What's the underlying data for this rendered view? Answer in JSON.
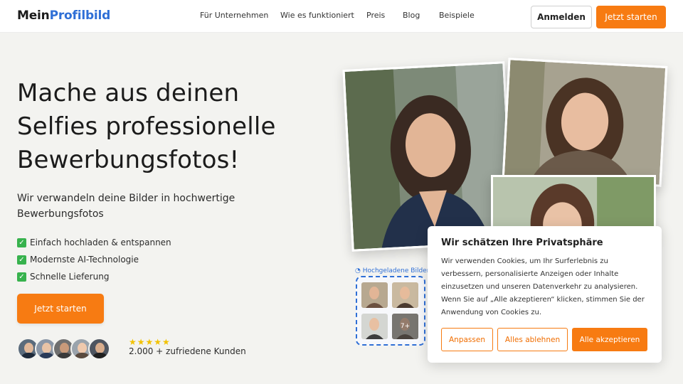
{
  "brand": {
    "part1": "Mein",
    "part2": "Profilbild"
  },
  "nav": [
    {
      "label": "Für Unternehmen"
    },
    {
      "label": "Wie es funktioniert"
    },
    {
      "label": "Preis"
    },
    {
      "label": "Blog"
    },
    {
      "label": "Beispiele"
    }
  ],
  "header": {
    "login_label": "Anmelden",
    "start_label": "Jetzt starten"
  },
  "hero": {
    "title": "Mache aus deinen Selfies professionelle Bewerbungsfotos!",
    "subtitle": "Wir verwandeln deine Bilder in hochwertige Bewerbungsfotos",
    "bullets": [
      {
        "icon": "checkmark-icon",
        "text": "Einfach hochladen & entspannen"
      },
      {
        "icon": "checkmark-icon",
        "text": "Modernste AI-Technologie"
      },
      {
        "icon": "checkmark-icon",
        "text": "Schnelle Lieferung"
      }
    ],
    "cta_label": "Jetzt starten",
    "stars": "★★★★★",
    "customers_text": "2.000 + zufriedene Kunden"
  },
  "uploads": {
    "label": "Hochgeladene Bilder",
    "more_count": "7+"
  },
  "cookie": {
    "title": "Wir schätzen Ihre Privatsphäre",
    "text": "Wir verwenden Cookies, um Ihr Surferlebnis zu verbessern, personalisierte Anzeigen oder Inhalte einzusetzen und unseren Datenverkehr zu analysieren. Wenn Sie auf „Alle akzeptieren“ klicken, stimmen Sie der Anwendung von Cookies zu.",
    "customize_label": "Anpassen",
    "reject_label": "Alles ablehnen",
    "accept_label": "Alle akzeptieren"
  },
  "colors": {
    "accent": "#f77b12",
    "brand_blue": "#2f6fd6",
    "check_green": "#37b24d",
    "star": "#f2c200"
  }
}
